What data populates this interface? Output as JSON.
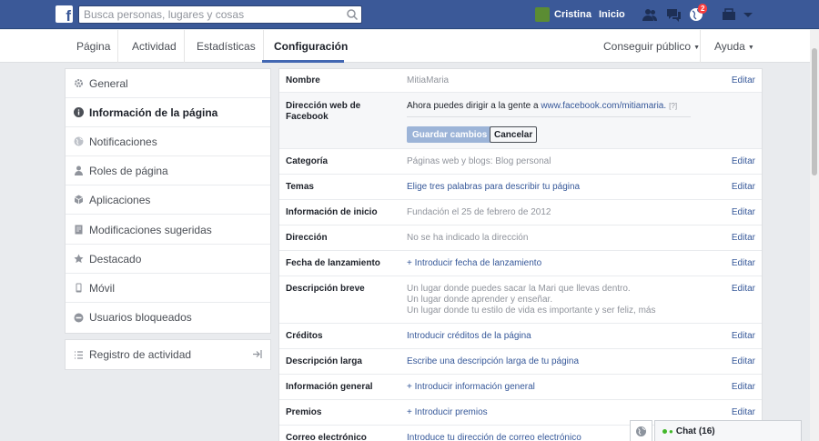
{
  "topbar": {
    "logo_letter": "f",
    "search_placeholder": "Busca personas, lugares y cosas",
    "user_name": "Cristina",
    "home_label": "Inicio",
    "notification_count": "2"
  },
  "tabs": {
    "items": [
      "Página",
      "Actividad",
      "Estadísticas",
      "Configuración"
    ],
    "active": "Configuración",
    "promote": "Conseguir público",
    "help": "Ayuda"
  },
  "sidebar": {
    "items": [
      {
        "label": "General",
        "icon": "gear-icon"
      },
      {
        "label": "Información de la página",
        "icon": "info-icon"
      },
      {
        "label": "Notificaciones",
        "icon": "globe-icon"
      },
      {
        "label": "Roles de página",
        "icon": "person-icon"
      },
      {
        "label": "Aplicaciones",
        "icon": "cube-icon"
      },
      {
        "label": "Modificaciones sugeridas",
        "icon": "document-icon"
      },
      {
        "label": "Destacado",
        "icon": "star-icon"
      },
      {
        "label": "Móvil",
        "icon": "mobile-icon"
      },
      {
        "label": "Usuarios bloqueados",
        "icon": "block-icon"
      }
    ],
    "active_index": 1,
    "activity_log": "Registro de actividad"
  },
  "content": {
    "edit_label": "Editar",
    "rows": [
      {
        "label": "Nombre",
        "value": "MitiaMaria"
      },
      {
        "label": "Dirección web de Facebook",
        "value_prefix": "Ahora puedes dirigir a la gente a ",
        "url": "www.facebook.com/mitiamaria.",
        "help": "[?]",
        "save": "Guardar cambios",
        "cancel": "Cancelar"
      },
      {
        "label": "Categoría",
        "value": "Páginas web y blogs: Blog personal"
      },
      {
        "label": "Temas",
        "value": "Elige tres palabras para describir tu página"
      },
      {
        "label": "Información de inicio",
        "value": "Fundación el 25 de febrero de 2012"
      },
      {
        "label": "Dirección",
        "value": "No se ha indicado la dirección"
      },
      {
        "label": "Fecha de lanzamiento",
        "value": "+ Introducir fecha de lanzamiento"
      },
      {
        "label": "Descripción breve",
        "lines": [
          "Un lugar donde puedes sacar la Mari que llevas dentro.",
          "Un lugar donde aprender y enseñar.",
          "Un lugar donde tu estilo de vida es importante y ser feliz, más"
        ]
      },
      {
        "label": "Créditos",
        "value": "Introducir créditos de la página"
      },
      {
        "label": "Descripción larga",
        "value": "Escribe una descripción larga de tu página"
      },
      {
        "label": "Información general",
        "value": "+ Introducir información general"
      },
      {
        "label": "Premios",
        "value": "+ Introducir premios"
      },
      {
        "label": "Correo electrónico",
        "value": "Introduce tu dirección de correo electrónico"
      }
    ]
  },
  "chat": {
    "label": "Chat (16)"
  },
  "colors": {
    "brand": "#3b5998",
    "link": "#365899",
    "badge": "#fa3e3e"
  }
}
